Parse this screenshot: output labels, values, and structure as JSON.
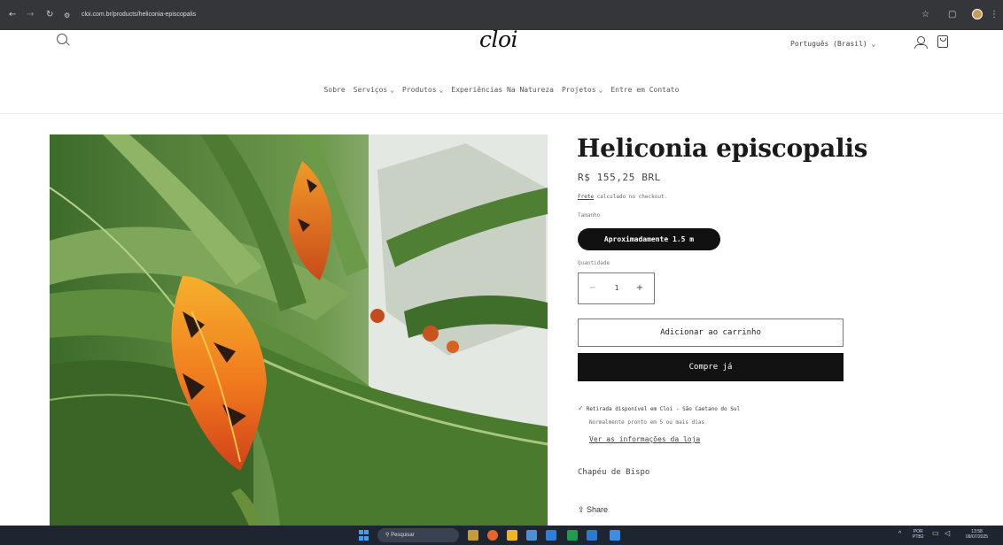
{
  "browser": {
    "url": "cloi.com.br/products/heliconia-episcopalis"
  },
  "store": {
    "logo": "cloi",
    "language": "Português (Brasil)",
    "nav": [
      {
        "label": "Sobre",
        "has_dropdown": false
      },
      {
        "label": "Serviços",
        "has_dropdown": true
      },
      {
        "label": "Produtos",
        "has_dropdown": true
      },
      {
        "label": "Experiências Na Natureza",
        "has_dropdown": false
      },
      {
        "label": "Projetos",
        "has_dropdown": true
      },
      {
        "label": "Entre em Contato",
        "has_dropdown": false
      }
    ]
  },
  "product": {
    "title": "Heliconia episcopalis",
    "price": "R$ 155,25 BRL",
    "shipping_link": "Frete",
    "shipping_text": "calculado no checkout.",
    "size_label": "Tamanho",
    "size_option": "Aproximadamente 1.5 m",
    "qty_label": "Quantidade",
    "qty_minus": "−",
    "qty_value": "1",
    "qty_plus": "+",
    "add_to_cart": "Adicionar ao carrinho",
    "buy_now": "Compre já",
    "pickup": "Retirada disponível em Cloi - São Caetano do Sul",
    "pickup_note": "Normalmente pronto em 5 ou mais dias",
    "store_info_link": "Ver as informações da loja",
    "common_name": "Chapéu de Bispo",
    "share": "Share"
  },
  "taskbar": {
    "search_placeholder": "Pesquisar",
    "language": "POR",
    "layout": "PTB2",
    "time": "13:58",
    "date": "09/07/2025"
  },
  "colors": {
    "browser_chrome": "#35363a",
    "primary_button": "#121212",
    "taskbar": "#1f2530",
    "check_green": "#2f7a2f"
  }
}
